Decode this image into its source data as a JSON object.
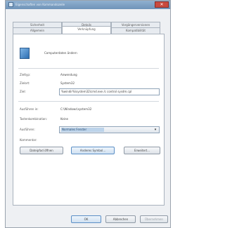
{
  "window": {
    "title": "Eigenschaften von Kommandozeile",
    "close_label": "✕"
  },
  "tabs_back": [
    {
      "label": "Sicherheit"
    },
    {
      "label": "Details"
    },
    {
      "label": "Vorgängerversionen"
    }
  ],
  "tabs_front": [
    {
      "label": "Allgemein"
    },
    {
      "label": "Verknüpfung",
      "active": true
    },
    {
      "label": "Kompatibilität"
    }
  ],
  "header": {
    "program_name": "Computerdaten ändern"
  },
  "fields": {
    "type_label": "Zieltyp:",
    "type_value": "Anwendung",
    "location_label": "Zielort:",
    "location_value": "System32",
    "target_label": "Ziel:",
    "target_value": "%windir%\\system32\\cmd.exe /c control sysdm.cpl",
    "start_in_label": "Ausführen in:",
    "start_in_value": "C:\\Windows\\system32",
    "shortcut_label": "Tastenkombination:",
    "shortcut_value": "Keine",
    "run_label": "Ausführen:",
    "run_value": "Normales Fenster",
    "comment_label": "Kommentar:"
  },
  "actions": {
    "open_location": "Dateipfad öffnen",
    "change_icon": "Anderes Symbol...",
    "advanced": "Erweitert..."
  },
  "footer": {
    "ok": "OK",
    "cancel": "Abbrechen",
    "apply": "Übernehmen"
  }
}
